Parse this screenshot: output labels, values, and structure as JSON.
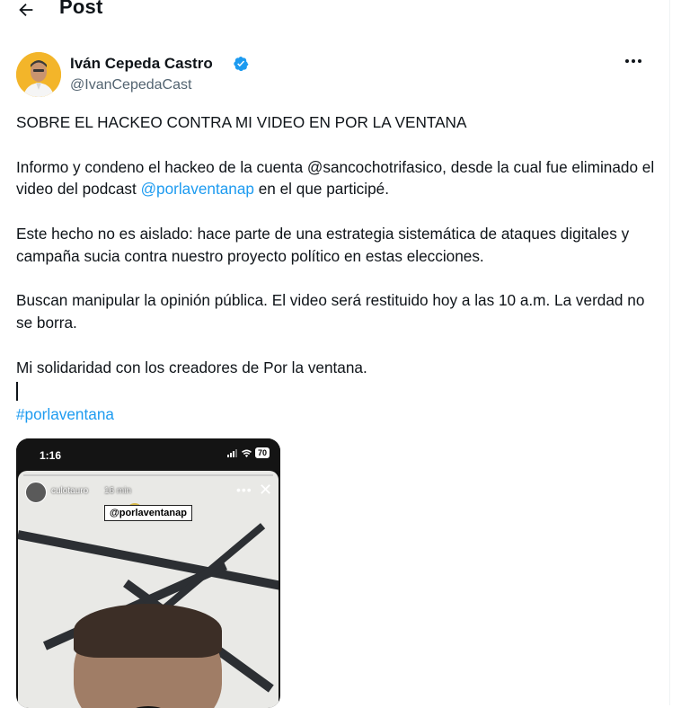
{
  "header": {
    "back_icon": "arrow-left-icon",
    "title": "Post"
  },
  "author": {
    "name": "Iván Cepeda Castro",
    "handle": "@IvanCepedaCast",
    "verified_icon": "verified-badge-icon",
    "verified_color": "#1d9bf0",
    "more_icon": "more-horizontal-icon"
  },
  "post": {
    "line_1": "SOBRE EL HACKEO CONTRA MI VIDEO EN POR LA VENTANA",
    "p2_before_link": "Informo y condeno el hackeo de la cuenta @sancochotrifasico, desde la cual fue eliminado el video del podcast ",
    "p2_link": "@porlaventanap",
    "p2_after_link": " en el que participé.",
    "p3": "Este hecho no es aislado: hace parte de una estrategia sistemática de ataques digitales y campaña sucia contra nuestro proyecto político en estas elecciones.",
    "p4": "Buscan manipular la opinión pública. El video será restituido hoy a las 10 a.m. La verdad no se borra.",
    "p5": "Mi solidaridad con los creadores de Por la ventana.",
    "hashtag": "#porlaventana",
    "link_color": "#1d9bf0"
  },
  "media": {
    "phone_time": "1:16",
    "battery": "70",
    "story_user": "culotauro",
    "story_time": "16 min",
    "sticker_text": "@porlaventanap"
  }
}
